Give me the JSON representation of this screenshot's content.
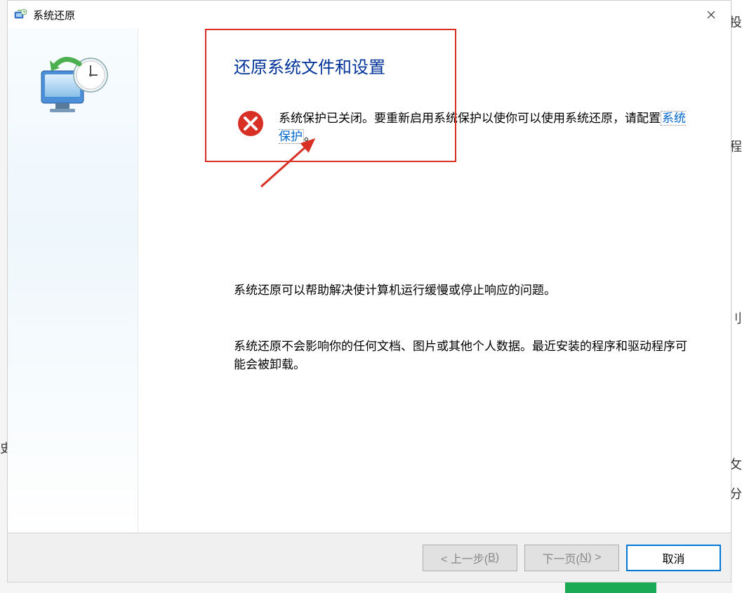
{
  "title": "系统还原",
  "heading": "还原系统文件和设置",
  "error": {
    "text_before_link": "系统保护已关闭。要重新启用系统保护以使你可以使用系统还原，请配置",
    "link_text": "系统保护",
    "text_after_link": "。"
  },
  "paragraph1": "系统还原可以帮助解决使计算机运行缓慢或停止响应的问题。",
  "paragraph2": "系统还原不会影响你的任何文档、图片或其他个人数据。最近安装的程序和驱动程序可能会被卸载。",
  "buttons": {
    "back_prefix": "< 上一步(",
    "back_letter": "B",
    "back_suffix": ")",
    "next_prefix": "下一页(",
    "next_letter": "N",
    "next_suffix": ") >",
    "cancel": "取消"
  },
  "bg_fragments": {
    "r1": "投",
    "r2": "程",
    "r3": "刂",
    "r4": "攵",
    "r5": "分",
    "l1": "史"
  }
}
